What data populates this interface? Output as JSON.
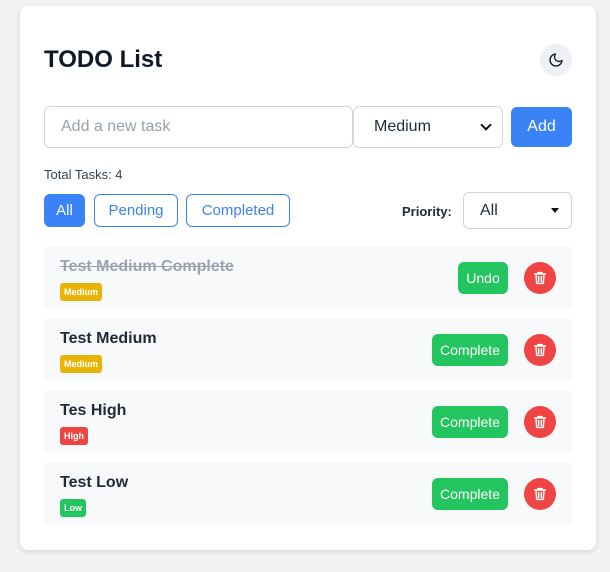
{
  "header": {
    "title": "TODO List",
    "theme_icon": "moon-icon"
  },
  "new_task": {
    "placeholder": "Add a new task",
    "priority": "Medium",
    "add_label": "Add"
  },
  "stats": {
    "total_label": "Total Tasks: 4"
  },
  "filters": {
    "all": "All",
    "pending": "Pending",
    "completed": "Completed",
    "active": "All"
  },
  "priority_filter": {
    "label": "Priority:",
    "value": "All"
  },
  "tasks": [
    {
      "title": "Test Medium Complete",
      "priority": "Medium",
      "completed": true,
      "action": "Undo"
    },
    {
      "title": "Test Medium",
      "priority": "Medium",
      "completed": false,
      "action": "Complete"
    },
    {
      "title": "Tes High",
      "priority": "High",
      "completed": false,
      "action": "Complete"
    },
    {
      "title": "Test Low",
      "priority": "Low",
      "completed": false,
      "action": "Complete"
    }
  ],
  "colors": {
    "primary": "#3b82f6",
    "success": "#22c55e",
    "danger": "#ef4444",
    "medium": "#eab308"
  }
}
